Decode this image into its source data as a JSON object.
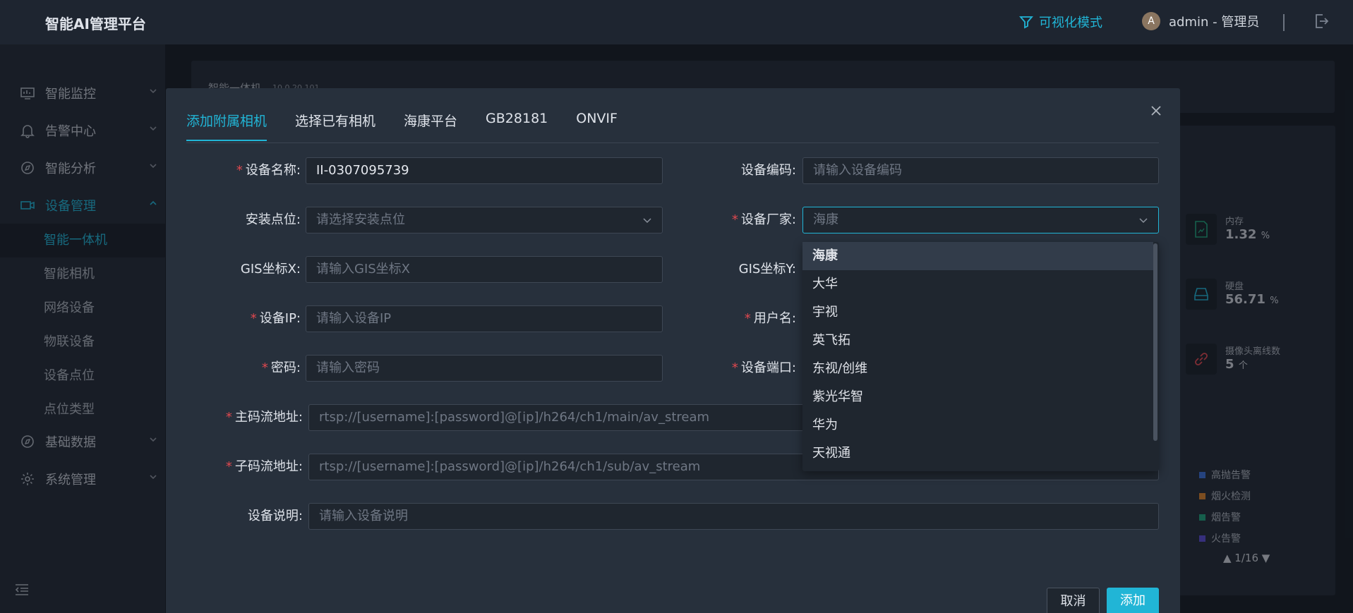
{
  "app": {
    "brand": "智能AI管理平台"
  },
  "topbar": {
    "vis_mode": "可视化模式",
    "avatar_letter": "A",
    "user": "admin - 管理员"
  },
  "sidebar": {
    "items": [
      {
        "label": "智能监控",
        "icon": "monitor-icon"
      },
      {
        "label": "告警中心",
        "icon": "bell-icon"
      },
      {
        "label": "智能分析",
        "icon": "compass-icon"
      },
      {
        "label": "设备管理",
        "icon": "device-icon",
        "expanded": true
      },
      {
        "label": "基础数据",
        "icon": "compass-icon"
      },
      {
        "label": "系统管理",
        "icon": "gear-icon"
      }
    ],
    "sub_items": [
      "智能一体机",
      "智能相机",
      "网络设备",
      "物联设备",
      "设备点位",
      "点位类型"
    ],
    "active_sub": "智能一体机"
  },
  "background": {
    "card_title": "智能一体机",
    "card_ip": "10.0.20.101",
    "stats": [
      {
        "label": "内存",
        "value": "1.32",
        "unit": "%"
      },
      {
        "label": "硬盘",
        "value": "56.71",
        "unit": "%"
      },
      {
        "label": "摄像头离线数",
        "value": "5",
        "unit": "个"
      }
    ],
    "legend": [
      {
        "label": "高抛告警",
        "color": "#3b6fd8"
      },
      {
        "label": "烟火检测",
        "color": "#d9822b"
      },
      {
        "label": "烟告警",
        "color": "#1fa37a"
      },
      {
        "label": "火告警",
        "color": "#5a4bd1"
      }
    ],
    "pager": "▲ 1/16 ▼"
  },
  "modal": {
    "tabs": [
      "添加附属相机",
      "选择已有相机",
      "海康平台",
      "GB28181",
      "ONVIF"
    ],
    "active_tab": 0,
    "fields": {
      "device_name": {
        "label": "设备名称:",
        "value": "II-0307095739"
      },
      "device_code": {
        "label": "设备编码:",
        "placeholder": "请输入设备编码"
      },
      "install_point": {
        "label": "安装点位:",
        "placeholder": "请选择安装点位"
      },
      "vendor": {
        "label": "设备厂家:",
        "value": "海康"
      },
      "gis_x": {
        "label": "GIS坐标X:",
        "placeholder": "请输入GIS坐标X"
      },
      "gis_y": {
        "label": "GIS坐标Y:"
      },
      "device_ip": {
        "label": "设备IP:",
        "placeholder": "请输入设备IP"
      },
      "username": {
        "label": "用户名:"
      },
      "password": {
        "label": "密码:",
        "placeholder": "请输入密码"
      },
      "port": {
        "label": "设备端口:"
      },
      "main_stream": {
        "label": "主码流地址:",
        "value": "rtsp://[username]:[password]@[ip]/h264/ch1/main/av_stream"
      },
      "sub_stream": {
        "label": "子码流地址:",
        "value": "rtsp://[username]:[password]@[ip]/h264/ch1/sub/av_stream"
      },
      "description": {
        "label": "设备说明:",
        "placeholder": "请输入设备说明"
      }
    },
    "vendor_options": [
      "海康",
      "大华",
      "宇视",
      "英飞拓",
      "东视/创维",
      "紫光华智",
      "华为",
      "天视通"
    ],
    "selected_vendor": "海康",
    "buttons": {
      "cancel": "取消",
      "add": "添加"
    }
  },
  "colors": {
    "accent": "#21b5d6",
    "required": "#e0484f"
  }
}
